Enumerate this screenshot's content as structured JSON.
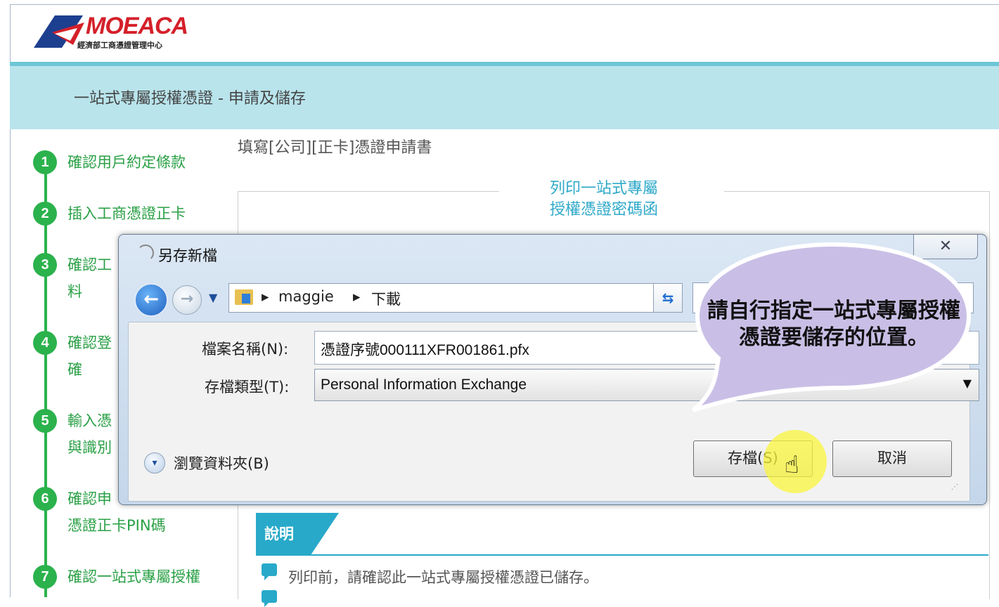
{
  "logo": {
    "name": "MOEACA",
    "subtitle": "經濟部工商憑證管理中心"
  },
  "header": {
    "title": "一站式專屬授權憑證 - 申請及儲存"
  },
  "form_title": "填寫[公司][正卡]憑證申請書",
  "steps": [
    {
      "num": "1",
      "label": "確認用戶約定條款"
    },
    {
      "num": "2",
      "label": "插入工商憑證正卡"
    },
    {
      "num": "3",
      "label_line1": "確認工",
      "label_line2": "料"
    },
    {
      "num": "4",
      "label_line1": "確認登",
      "label_line2": "確"
    },
    {
      "num": "5",
      "label_line1": "輸入憑",
      "label_line2": "與識別"
    },
    {
      "num": "6",
      "label_line1": "確認申",
      "label_line2": "憑證正卡PIN碼"
    },
    {
      "num": "7",
      "label": "確認一站式專屬授權"
    }
  ],
  "section_legend": {
    "line1": "列印一站式專屬",
    "line2": "授權憑證密碼函"
  },
  "explanation": {
    "title": "說明",
    "note1": "列印前，請確認此一站式專屬授權憑證已儲存。"
  },
  "dialog": {
    "title": "另存新檔",
    "close": "✕",
    "path": {
      "crumb1": "maggie",
      "crumb2": "下載"
    },
    "filename_label": "檔案名稱(N):",
    "filename_value": "憑證序號000111XFR001861.pfx",
    "filetype_label": "存檔類型(T):",
    "filetype_value": "Personal Information Exchange",
    "browse_label": "瀏覽資料夾(B)",
    "save_button": "存檔(S)",
    "cancel_button": "取消"
  },
  "callout": {
    "text": "請自行指定一站式專屬授權憑證要儲存的位置。"
  },
  "colors": {
    "accent_teal": "#28a9c9",
    "step_green": "#2bb24c",
    "banner": "#b9e4ec",
    "callout": "#c9bfe6"
  }
}
